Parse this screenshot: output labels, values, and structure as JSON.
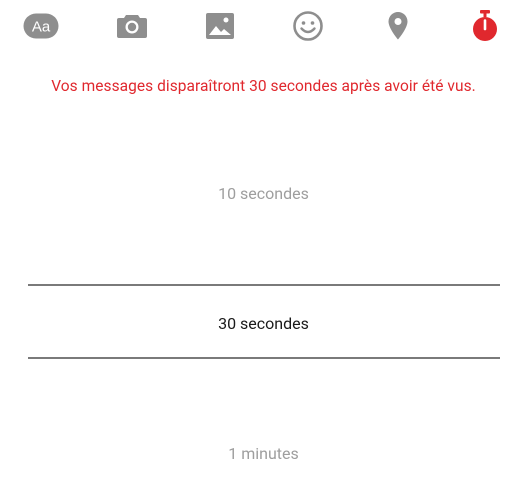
{
  "toolbar": {
    "text_button_label": "Aa",
    "icons": [
      "text-format-icon",
      "camera-icon",
      "image-icon",
      "emoji-icon",
      "location-icon",
      "timer-icon"
    ],
    "accent_color": "#e0282e",
    "icon_color": "#8e8e8e"
  },
  "notice": {
    "text": "Vos messages disparaîtront 30 secondes après avoir été vus."
  },
  "timer_picker": {
    "options": [
      "10 secondes",
      "30 secondes",
      "1 minutes"
    ],
    "selected": "30 secondes"
  }
}
